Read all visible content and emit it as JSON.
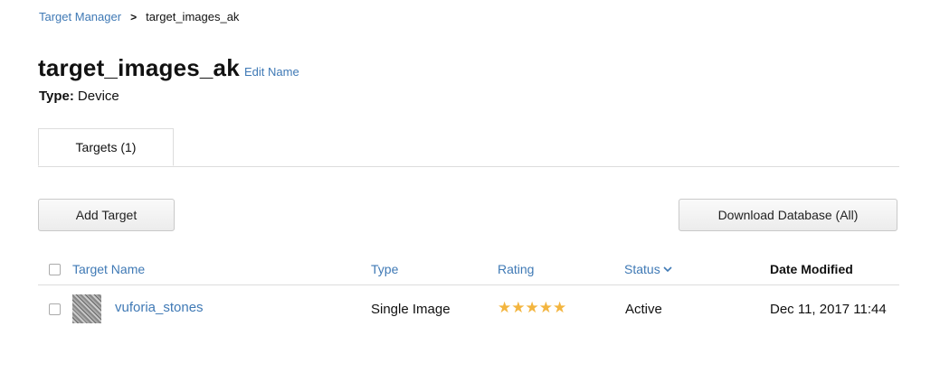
{
  "breadcrumb": {
    "parent": "Target Manager",
    "separator": ">",
    "current": "target_images_ak"
  },
  "header": {
    "title": "target_images_ak",
    "edit_label": "Edit Name",
    "type_label": "Type:",
    "type_value": "Device"
  },
  "tabs": [
    {
      "label": "Targets (1)",
      "active": true
    }
  ],
  "toolbar": {
    "add_label": "Add Target",
    "download_label": "Download Database (All)"
  },
  "table": {
    "columns": [
      "Target Name",
      "Type",
      "Rating",
      "Status",
      "Date Modified"
    ],
    "status_sort_icon": "chevron-down-icon",
    "rows": [
      {
        "name": "vuforia_stones",
        "type": "Single Image",
        "rating": 5,
        "rating_stars": "★★★★★",
        "status": "Active",
        "date_modified": "Dec 11, 2017 11:44"
      }
    ]
  },
  "colors": {
    "link": "#3f79b5",
    "star": "#f3b53f",
    "divider": "#dddddd"
  }
}
